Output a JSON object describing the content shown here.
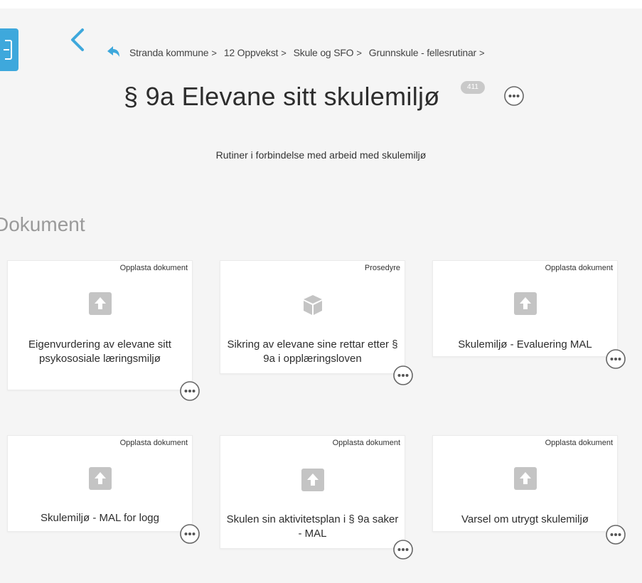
{
  "breadcrumb": {
    "items": [
      "Stranda kommune",
      "12 Oppvekst",
      "Skule og SFO",
      "Grunnskule - fellesrutinar"
    ],
    "separator": ">"
  },
  "page": {
    "title": "§ 9a Elevane sitt skulemiljø",
    "view_count": "411",
    "subtitle": "Rutiner i forbindelse med arbeid med skulemiljø",
    "section_title": "Dokument"
  },
  "colors": {
    "accent": "#3ea8dc",
    "background": "#f5f5f5",
    "card": "#ffffff",
    "icon": "#c4c4c4"
  },
  "documents": [
    {
      "type": "Opplasta dokument",
      "title": "Eigenvurdering av elevane sitt psykososiale læringsmiljø",
      "icon": "upload-icon"
    },
    {
      "type": "Prosedyre",
      "title": "Sikring av elevane sine rettar etter § 9a i opplæringsloven",
      "icon": "cube-icon"
    },
    {
      "type": "Opplasta dokument",
      "title": "Skulemiljø - Evaluering MAL",
      "icon": "upload-icon"
    },
    {
      "type": "Opplasta dokument",
      "title": "Skulemiljø - MAL for logg",
      "icon": "upload-icon"
    },
    {
      "type": "Opplasta dokument",
      "title": "Skulen sin aktivitetsplan i § 9a saker - MAL",
      "icon": "upload-icon"
    },
    {
      "type": "Opplasta dokument",
      "title": "Varsel om utrygt skulemiljø",
      "icon": "upload-icon"
    }
  ]
}
